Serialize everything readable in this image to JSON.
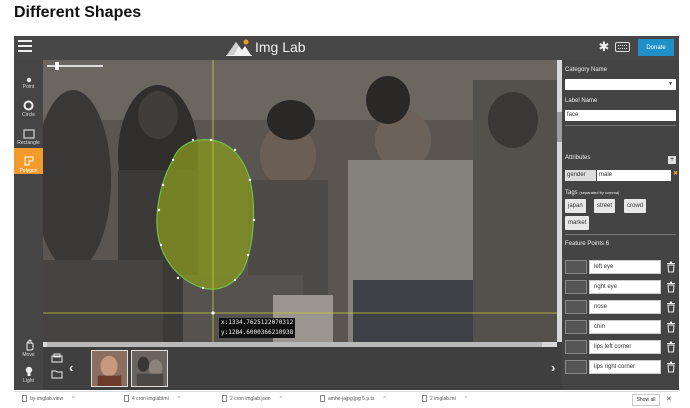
{
  "heading": "Different Shapes",
  "app": {
    "title": "Img Lab",
    "donate_label": "Donate"
  },
  "tools": [
    {
      "label": "Point",
      "icon": "point-icon"
    },
    {
      "label": "Circle",
      "icon": "circle-icon"
    },
    {
      "label": "Rectangle",
      "icon": "rectangle-icon"
    },
    {
      "label": "Polygon",
      "icon": "polygon-icon",
      "active": true
    },
    {
      "label": "Move",
      "icon": "move-icon"
    },
    {
      "label": "Light",
      "icon": "light-icon"
    }
  ],
  "canvas": {
    "coord_x": "x:1334.7625122070312",
    "coord_y": "y:1284.6000366210938"
  },
  "panel": {
    "category_label": "Category Name",
    "category_value": "",
    "label_name_label": "Label Name",
    "label_name_value": "face",
    "attributes_label": "Attributes",
    "attr_key": "gender",
    "attr_value": "male",
    "tags_label": "Tags",
    "tags_hint": "(separated by comma)",
    "tags": [
      "japan",
      "street",
      "crowd",
      "market"
    ],
    "feature_points_label": "Feature Points",
    "feature_points_count": "6",
    "feature_points": [
      "left eye",
      "right eye",
      "nose",
      "chin",
      "lips left corner",
      "lips right corner"
    ]
  },
  "downloads": {
    "items": [
      "by-imglab.view",
      "4 cron imglabtml",
      "2 cron imglab.json",
      "amhe-jajpg.jpg 5.p.ts",
      "2 imglab.mt"
    ],
    "show_all": "Show all"
  },
  "colors": {
    "accent": "#f39a2d",
    "donate": "#1e90c7",
    "polygon_fill": "#8a9a1e",
    "polygon_stroke": "#6fc04a",
    "guide_line": "#c8cc3a"
  }
}
